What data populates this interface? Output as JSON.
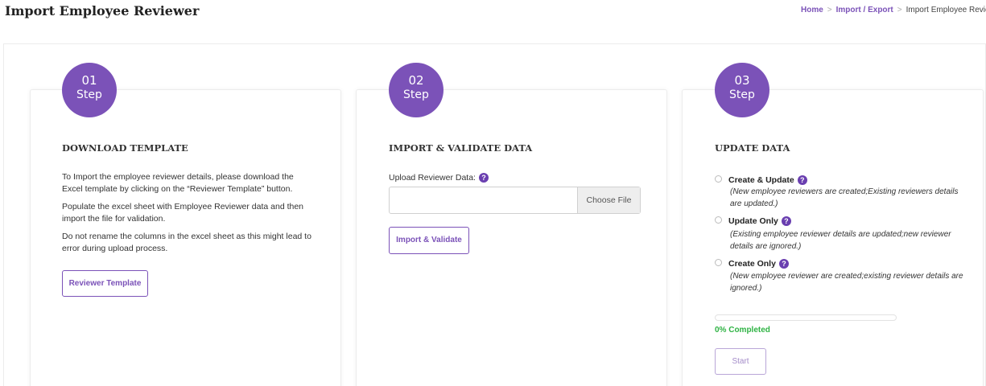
{
  "page": {
    "title": "Import Employee Reviewer"
  },
  "breadcrumb": {
    "home": "Home",
    "section": "Import / Export",
    "current": "Import Employee Reviewer"
  },
  "steps": [
    {
      "number": "01",
      "label": "Step",
      "title": "DOWNLOAD TEMPLATE"
    },
    {
      "number": "02",
      "label": "Step",
      "title": "IMPORT & VALIDATE DATA"
    },
    {
      "number": "03",
      "label": "Step",
      "title": "UPDATE DATA"
    }
  ],
  "step1": {
    "paragraphs": [
      "To Import the employee reviewer details, please download the Excel template by clicking on the “Reviewer Template” button.",
      "Populate the excel sheet with Employee Reviewer data and then import the file for validation.",
      "Do not rename the columns in the excel sheet as this might lead to error during upload process."
    ],
    "button_label": "Reviewer Template"
  },
  "step2": {
    "upload_label": "Upload Reviewer Data:",
    "choose_file_label": "Choose File",
    "button_label": "Import & Validate"
  },
  "step3": {
    "options": [
      {
        "label": "Create & Update",
        "description": "(New employee reviewers are created;Existing reviewers details are updated.)"
      },
      {
        "label": "Update Only",
        "description": "(Existing employee reviewer details are updated;new reviewer details are ignored.)"
      },
      {
        "label": "Create Only",
        "description": "(New employee reviewer are created;existing reviewer details are ignored.)"
      }
    ],
    "progress_value": 0,
    "progress_text": "0% Completed",
    "start_label": "Start"
  },
  "colors": {
    "accent": "#7b52b8",
    "success": "#2fb344"
  },
  "icons": {
    "help": "question-circle-icon"
  }
}
